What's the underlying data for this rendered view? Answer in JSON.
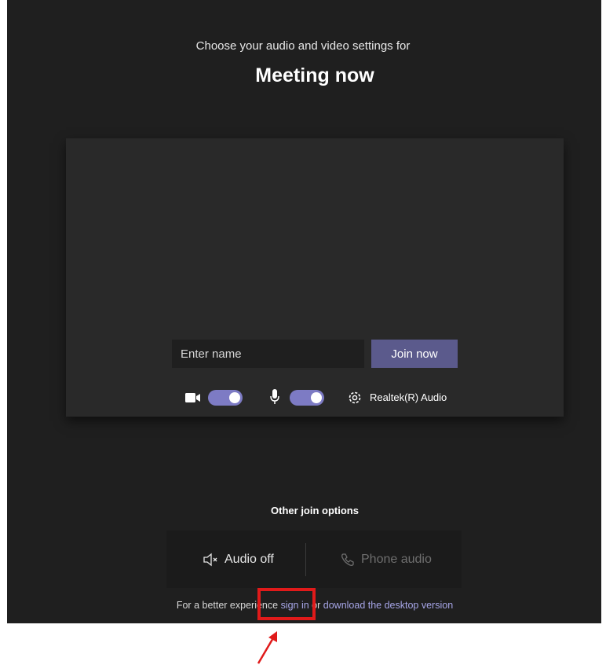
{
  "header": {
    "subtitle": "Choose your audio and video settings for",
    "title": "Meeting now"
  },
  "join_form": {
    "name_placeholder": "Enter name",
    "join_label": "Join now"
  },
  "device_controls": {
    "camera_on": true,
    "microphone_on": true,
    "audio_device": "Realtek(R) Audio",
    "icons": [
      "camera-icon",
      "microphone-icon",
      "gear-icon"
    ]
  },
  "other_options": {
    "title": "Other join options",
    "audio_off": "Audio off",
    "phone_audio": "Phone audio",
    "icons": [
      "speaker-muted-icon",
      "phone-icon"
    ]
  },
  "footer": {
    "prefix": "For a better experience ",
    "sign_in": "sign in",
    "middle": " or ",
    "download": "download the desktop version"
  },
  "colors": {
    "background": "#1f1f1f",
    "preview": "#292929",
    "join_button": "#5b5a8c",
    "toggle": "#7d7bc4",
    "link": "#a7a6e8",
    "annotation": "#e01a1a"
  }
}
